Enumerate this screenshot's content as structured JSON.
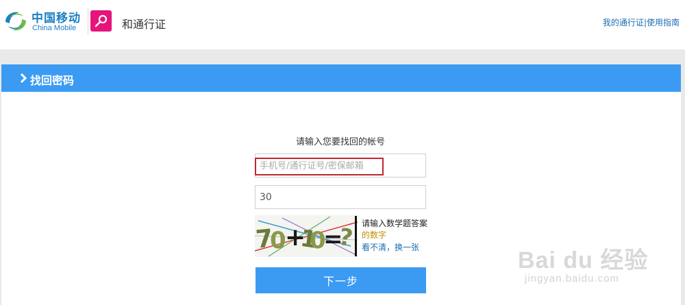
{
  "header": {
    "brand_cn": "中国移动",
    "brand_en": "China Mobile",
    "app_name": "和通行证",
    "links": [
      "我的通行证",
      "使用指南"
    ],
    "link_separator": "|"
  },
  "panel": {
    "title": "找回密码"
  },
  "form": {
    "prompt": "请输入您要找回的帐号",
    "account_placeholder": "手机号/通行证号/密保邮箱",
    "captcha_answer_value": "30",
    "captcha_hint_1": "请输入数学题答案",
    "captcha_hint_2": "的数字",
    "captcha_refresh": "看不清，换一张",
    "captcha_image_text": "70+10=?",
    "next_button": "下一步"
  },
  "watermark": {
    "big": "Bai du 经验",
    "small": "jingyan.baidu.com"
  },
  "colors": {
    "brand_blue": "#1b7fc4",
    "accent_blue": "#3b9bf3",
    "app_pink": "#e5157b",
    "highlight_red": "#c0262d",
    "band_gray": "#e9e9e9"
  },
  "icons": {
    "brand": "china-mobile-logo",
    "app": "search-key-icon",
    "panel_arrow": "chevron-right-icon"
  }
}
